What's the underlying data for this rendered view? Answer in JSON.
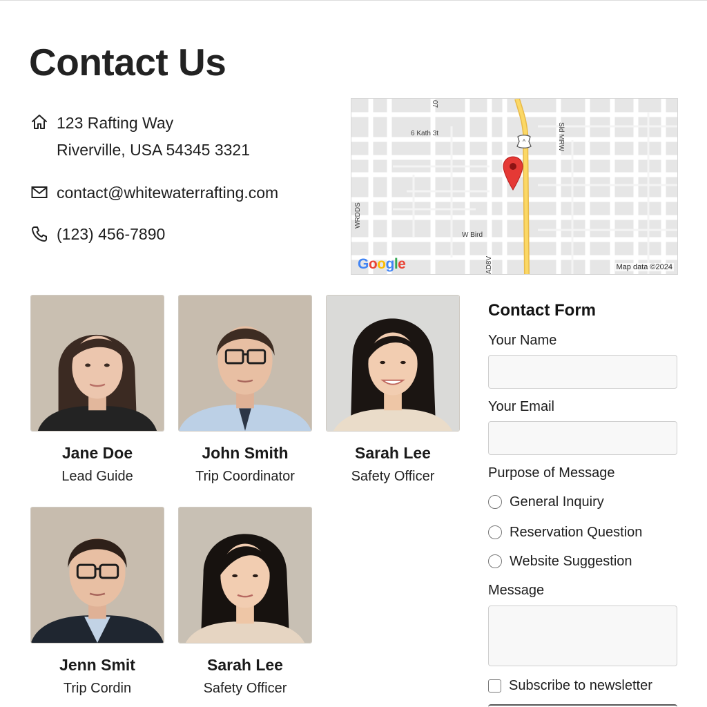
{
  "page": {
    "title": "Contact Us"
  },
  "contact": {
    "address_line1": "123 Rafting Way",
    "address_line2": "Riverville, USA 54345 3321",
    "email": "contact@whitewaterrafting.com",
    "phone": "(123) 456-7890",
    "icons": {
      "address": "home-icon",
      "email": "mail-icon",
      "phone": "phone-icon"
    }
  },
  "map": {
    "street_labels": [
      "6 Kath 3t",
      "W Bird",
      "Sld MRW",
      "WRDDS",
      "AD8V",
      "07"
    ],
    "logo": "Google",
    "attribution": "Map data ©2024",
    "colors": {
      "background": "#e6e6e6",
      "road": "#ffffff",
      "highway": "#f5c842",
      "pin": "#e53935"
    }
  },
  "team": [
    {
      "name": "Jane Doe",
      "role": "Lead Guide"
    },
    {
      "name": "John Smith",
      "role": "Trip Coordinator"
    },
    {
      "name": "Sarah Lee",
      "role": "Safety Officer"
    },
    {
      "name": "Jenn Smit",
      "role": "Trip Cordin"
    },
    {
      "name": "Sarah Lee",
      "role": "Safety Officer"
    }
  ],
  "form": {
    "title": "Contact Form",
    "name_label": "Your Name",
    "name_value": "",
    "email_label": "Your Email",
    "email_value": "",
    "purpose_label": "Purpose of Message",
    "purpose_options": [
      "General Inquiry",
      "Reservation Question",
      "Website Suggestion"
    ],
    "message_label": "Message",
    "message_value": "",
    "newsletter_label": "Subscribe to newsletter"
  }
}
